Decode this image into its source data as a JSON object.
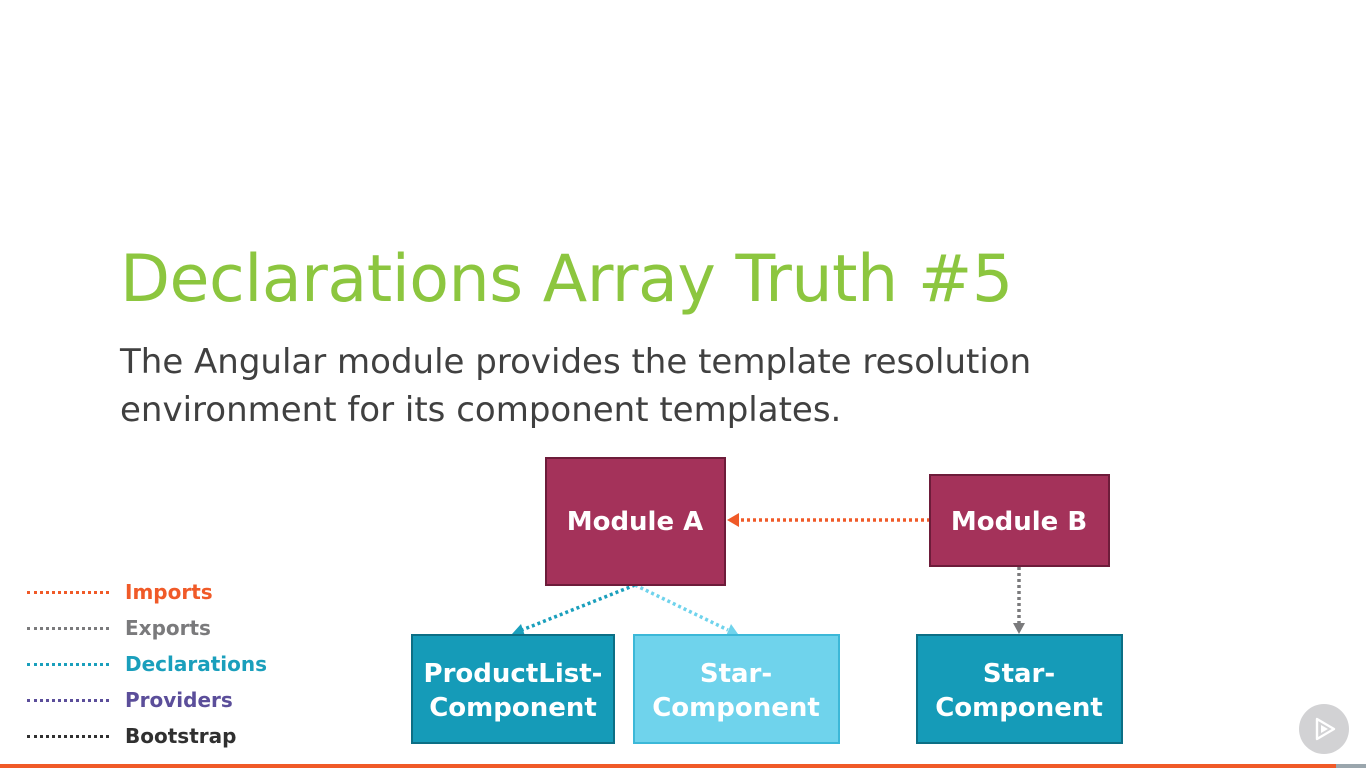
{
  "slide": {
    "title": "Declarations Array Truth #5",
    "subtitle_lines": [
      "The Angular module provides the template resolution",
      "environment for its component templates."
    ]
  },
  "diagram": {
    "nodes": {
      "module_a": {
        "lines": [
          "Module A"
        ]
      },
      "module_b": {
        "lines": [
          "Module B"
        ]
      },
      "productlist_component": {
        "lines": [
          "ProductList-",
          "Component"
        ]
      },
      "star_component_a": {
        "lines": [
          "Star-",
          "Component"
        ]
      },
      "star_component_b": {
        "lines": [
          "Star-",
          "Component"
        ]
      }
    }
  },
  "legend": {
    "items": [
      {
        "label": "Imports",
        "color": "#f05a28"
      },
      {
        "label": "Exports",
        "color": "#7a7a7c"
      },
      {
        "label": "Declarations",
        "color": "#1a9fbc"
      },
      {
        "label": "Providers",
        "color": "#5b4e9a"
      },
      {
        "label": "Bootstrap",
        "color": "#303030"
      }
    ]
  },
  "colors": {
    "title": "#8cc63f",
    "subtitle": "#404040",
    "module": "#a4325a",
    "module_border": "#6d1c3a",
    "component": "#159bb8",
    "component_border": "#0c6f85",
    "component_light": "#6fd3ec",
    "component_light_border": "#3cb8d8",
    "imports": "#f05a28",
    "exports": "#7a7a7c",
    "declarations": "#1a9fbc",
    "declarations_light": "#6fd3ec",
    "bottom_bar": "#f05a28"
  },
  "progress": {
    "fraction": 0.978
  },
  "icons": {
    "play": "play-icon"
  }
}
